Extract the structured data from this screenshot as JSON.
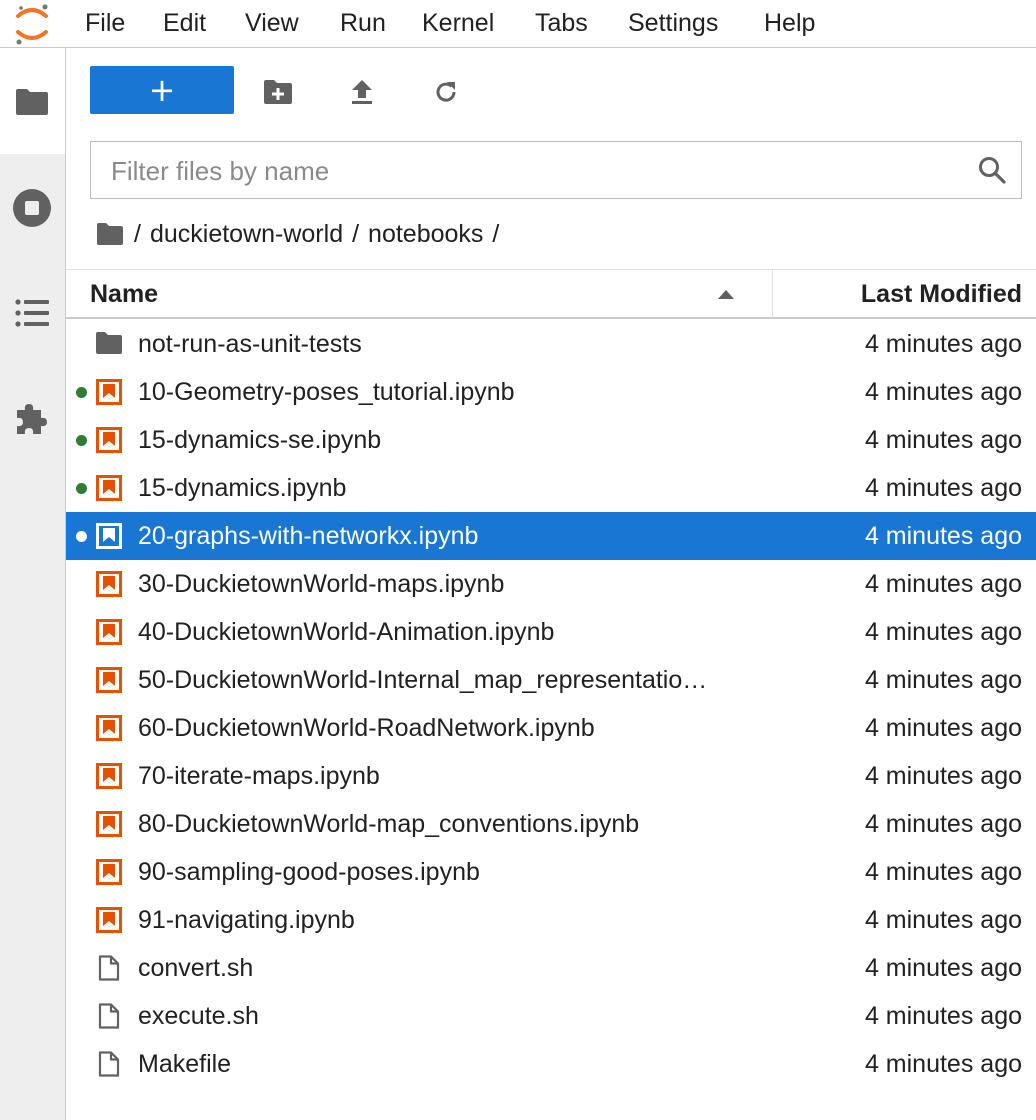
{
  "menu": [
    "File",
    "Edit",
    "View",
    "Run",
    "Kernel",
    "Tabs",
    "Settings",
    "Help"
  ],
  "toolbar": {
    "new_label": "+"
  },
  "filter": {
    "placeholder": "Filter files by name"
  },
  "breadcrumb": {
    "root": "/",
    "parts": [
      "duckietown-world",
      "notebooks"
    ],
    "trailing": "/"
  },
  "columns": {
    "name": "Name",
    "modified": "Last Modified"
  },
  "colors": {
    "accent": "#1976d2",
    "notebook": "#e65100",
    "running": "#2e7d32"
  },
  "files": [
    {
      "name": "not-run-as-unit-tests",
      "type": "folder",
      "modified": "4 minutes ago",
      "running": false,
      "selected": false
    },
    {
      "name": "10-Geometry-poses_tutorial.ipynb",
      "type": "notebook",
      "modified": "4 minutes ago",
      "running": true,
      "selected": false
    },
    {
      "name": "15-dynamics-se.ipynb",
      "type": "notebook",
      "modified": "4 minutes ago",
      "running": true,
      "selected": false
    },
    {
      "name": "15-dynamics.ipynb",
      "type": "notebook",
      "modified": "4 minutes ago",
      "running": true,
      "selected": false
    },
    {
      "name": "20-graphs-with-networkx.ipynb",
      "type": "notebook",
      "modified": "4 minutes ago",
      "running": true,
      "selected": true
    },
    {
      "name": "30-DuckietownWorld-maps.ipynb",
      "type": "notebook",
      "modified": "4 minutes ago",
      "running": false,
      "selected": false
    },
    {
      "name": "40-DuckietownWorld-Animation.ipynb",
      "type": "notebook",
      "modified": "4 minutes ago",
      "running": false,
      "selected": false
    },
    {
      "name": "50-DuckietownWorld-Internal_map_representatio…",
      "type": "notebook",
      "modified": "4 minutes ago",
      "running": false,
      "selected": false
    },
    {
      "name": "60-DuckietownWorld-RoadNetwork.ipynb",
      "type": "notebook",
      "modified": "4 minutes ago",
      "running": false,
      "selected": false
    },
    {
      "name": "70-iterate-maps.ipynb",
      "type": "notebook",
      "modified": "4 minutes ago",
      "running": false,
      "selected": false
    },
    {
      "name": "80-DuckietownWorld-map_conventions.ipynb",
      "type": "notebook",
      "modified": "4 minutes ago",
      "running": false,
      "selected": false
    },
    {
      "name": "90-sampling-good-poses.ipynb",
      "type": "notebook",
      "modified": "4 minutes ago",
      "running": false,
      "selected": false
    },
    {
      "name": "91-navigating.ipynb",
      "type": "notebook",
      "modified": "4 minutes ago",
      "running": false,
      "selected": false
    },
    {
      "name": "convert.sh",
      "type": "file",
      "modified": "4 minutes ago",
      "running": false,
      "selected": false
    },
    {
      "name": "execute.sh",
      "type": "file",
      "modified": "4 minutes ago",
      "running": false,
      "selected": false
    },
    {
      "name": "Makefile",
      "type": "file",
      "modified": "4 minutes ago",
      "running": false,
      "selected": false
    }
  ]
}
